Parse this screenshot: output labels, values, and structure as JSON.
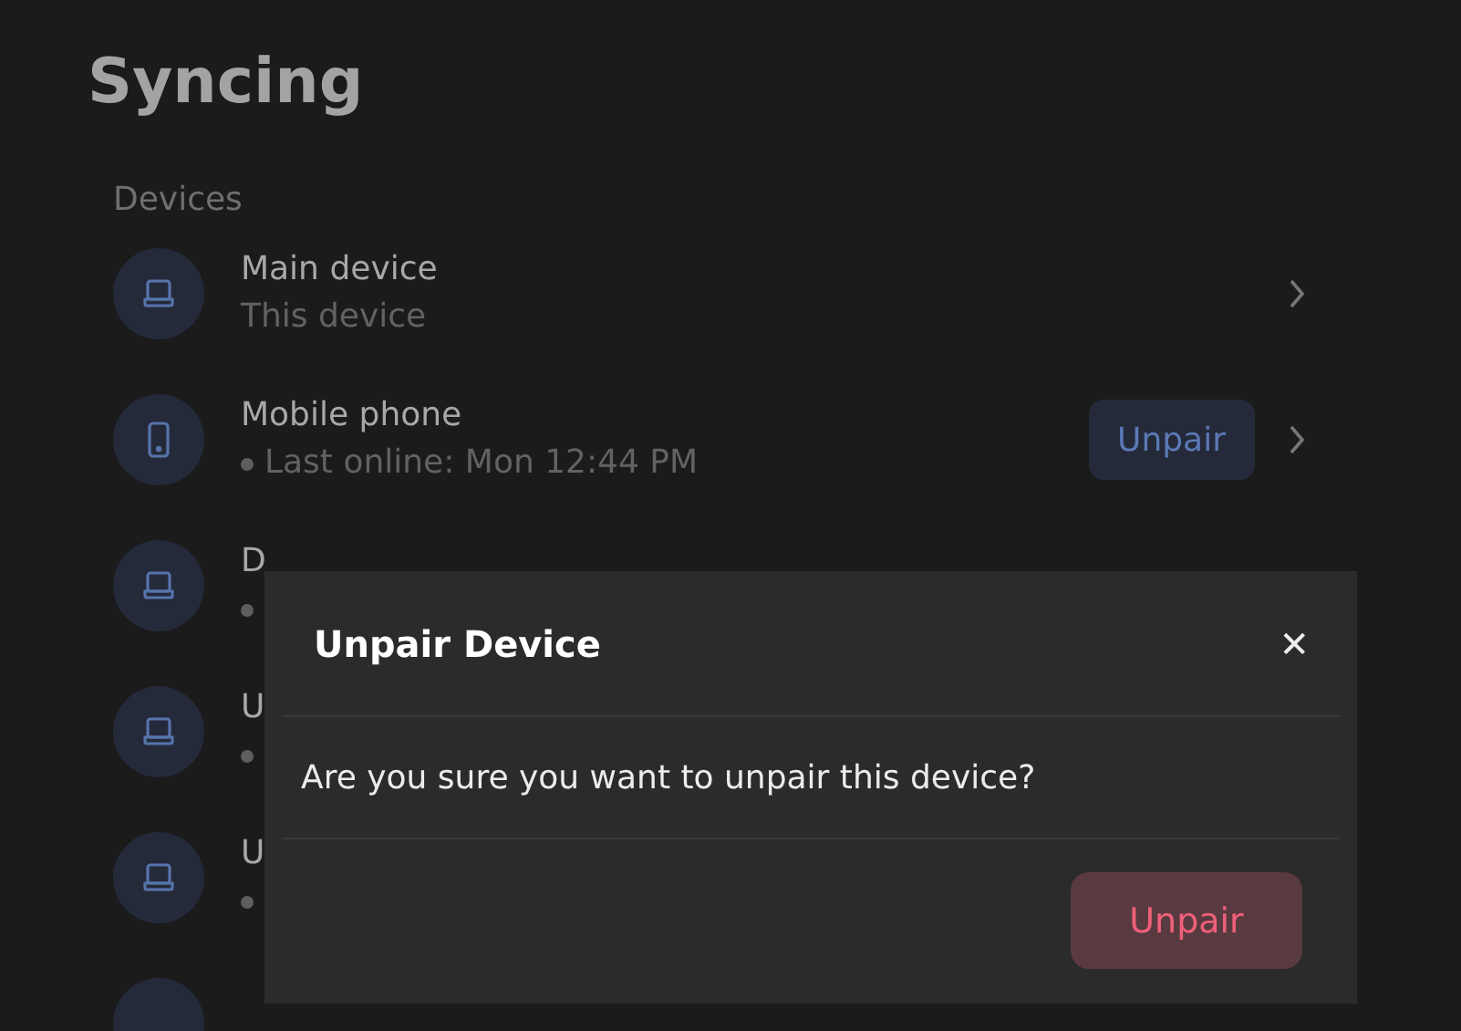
{
  "title": "Syncing",
  "section": "Devices",
  "devices": [
    {
      "kind": "laptop",
      "name": "Main device",
      "subtitle": "This device",
      "status_dot": false,
      "chevron": true
    },
    {
      "kind": "phone",
      "name": "Mobile phone",
      "subtitle": "Last online: Mon 12:44 PM",
      "status_dot": true,
      "unpair": "Unpair",
      "chevron": true
    },
    {
      "kind": "laptop",
      "name": "D",
      "status_dot": true
    },
    {
      "kind": "laptop",
      "name": "U",
      "status_dot": true
    },
    {
      "kind": "laptop",
      "name": "U",
      "status_dot": true
    }
  ],
  "dialog": {
    "title": "Unpair Device",
    "close": "✕",
    "message": "Are you sure you want to unpair this device?",
    "confirm": "Unpair"
  }
}
